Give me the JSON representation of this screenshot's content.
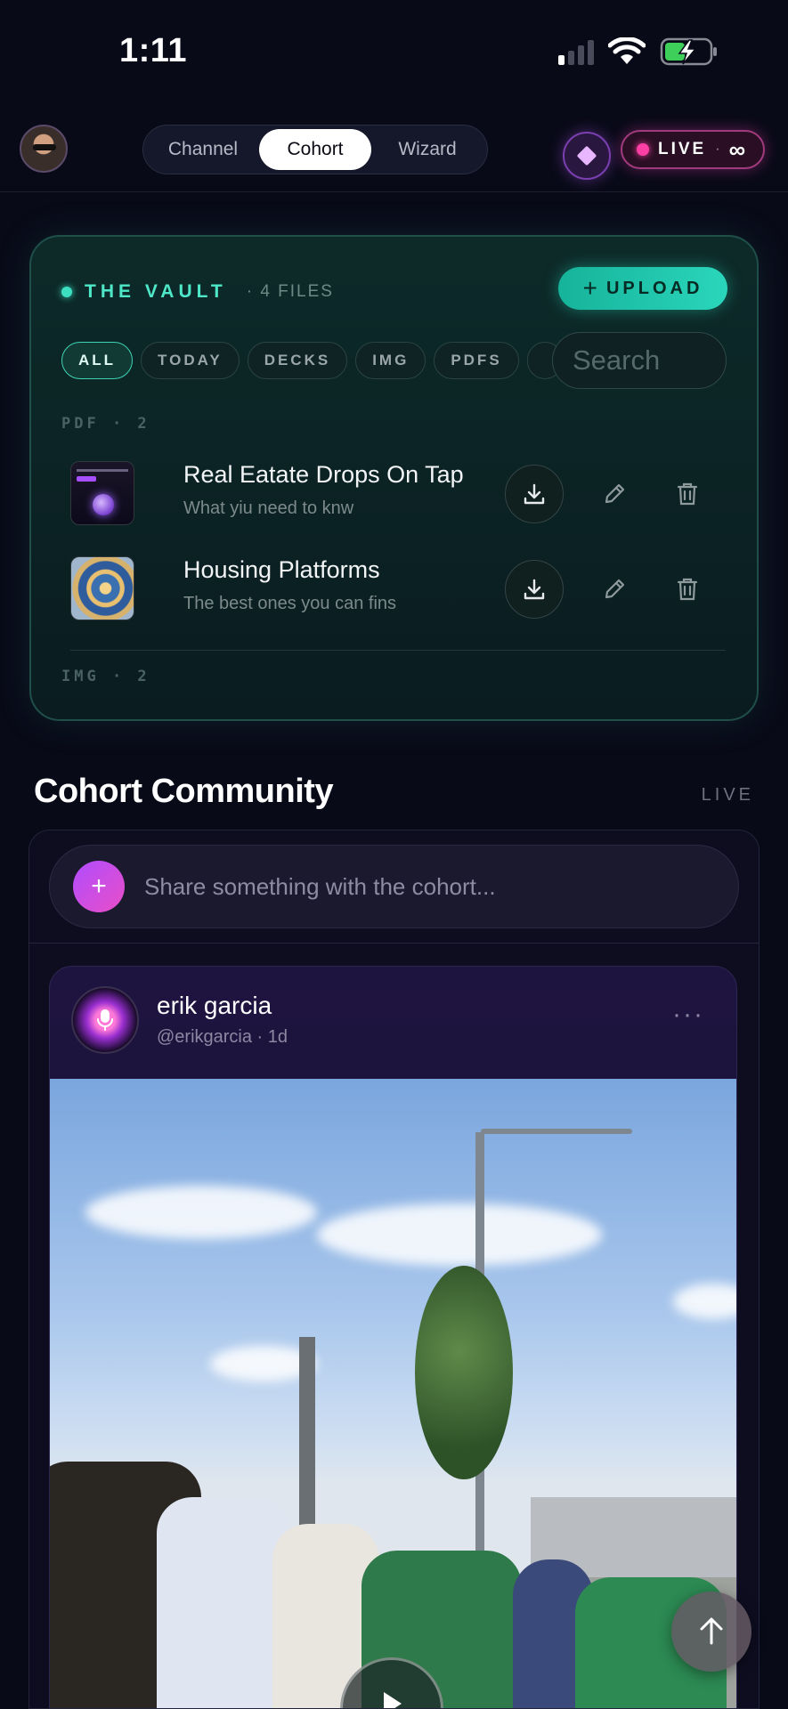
{
  "status_bar": {
    "time": "1:11"
  },
  "nav": {
    "tabs": [
      {
        "label": "Channel"
      },
      {
        "label": "Cohort",
        "active": true
      },
      {
        "label": "Wizard"
      }
    ],
    "live": {
      "label": "LIVE",
      "separator": "·",
      "symbol": "∞"
    }
  },
  "vault": {
    "title": "THE VAULT",
    "count": "· 4 FILES",
    "upload_label": "UPLOAD",
    "filters": [
      "ALL",
      "TODAY",
      "DECKS",
      "IMG",
      "PDFS"
    ],
    "active_filter": "ALL",
    "search_placeholder": "Search",
    "groups": [
      {
        "label": "PDF · 2",
        "files": [
          {
            "title": "Real Eatate Drops On Tap",
            "subtitle": "What yiu need to knw"
          },
          {
            "title": "Housing Platforms",
            "subtitle": "The best ones you can fins"
          }
        ]
      },
      {
        "label": "IMG · 2",
        "files": []
      }
    ]
  },
  "community": {
    "title": "Cohort Community",
    "status": "LIVE",
    "composer_placeholder": "Share something with the cohort...",
    "post": {
      "author": "erik garcia",
      "meta": "@erikgarcia · 1d"
    }
  },
  "colors": {
    "accent_teal": "#2ad6bb",
    "live_pink": "#ff3fa4",
    "composer_purple": "#b04cff"
  },
  "icons": [
    "signal-icon",
    "wifi-icon",
    "battery-charging-icon",
    "diamond-icon",
    "plus-icon",
    "download-icon",
    "pencil-icon",
    "trash-icon",
    "microphone-icon",
    "more-icon",
    "play-icon",
    "arrow-up-icon"
  ]
}
